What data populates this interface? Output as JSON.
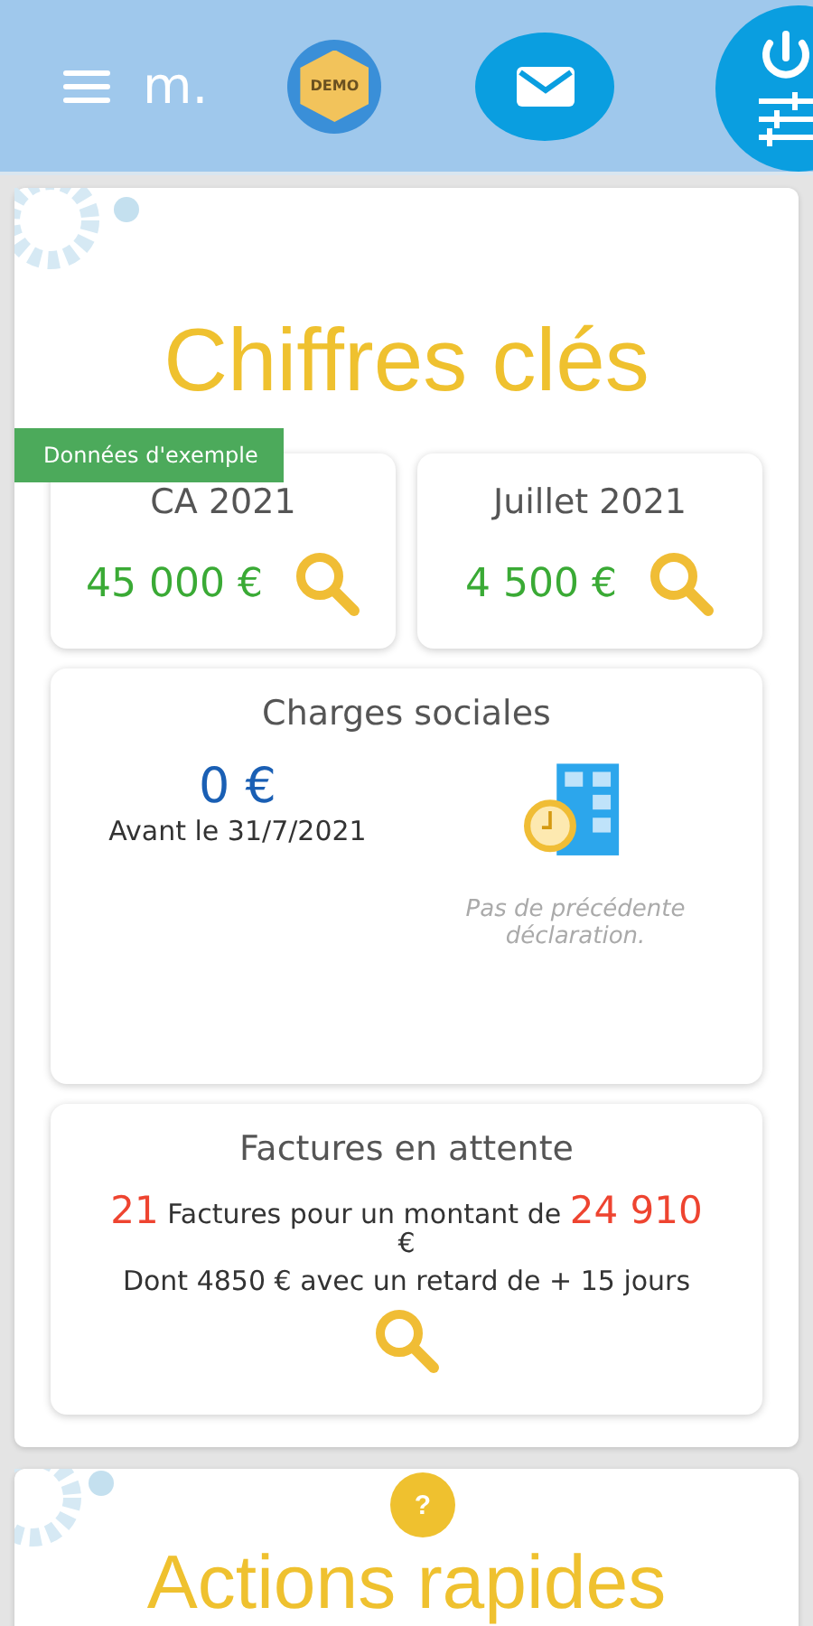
{
  "header": {
    "logo": "m.",
    "demo_badge": "DEMO"
  },
  "key_figures": {
    "title": "Chiffres clés",
    "sample_banner": "Données d'exemple",
    "tiles": [
      {
        "label": "CA 2021",
        "amount": "45 000 €"
      },
      {
        "label": "Juillet 2021",
        "amount": "4 500 €"
      }
    ],
    "social_charges": {
      "title": "Charges sociales",
      "amount": "0 €",
      "due": "Avant le 31/7/2021",
      "note": "Pas de précédente déclaration."
    },
    "pending_invoices": {
      "title": "Factures en attente",
      "count": "21",
      "text": "Factures pour un montant de",
      "amount": "24 910",
      "currency": "€",
      "overdue": "Dont 4850 € avec un retard de + 15 jours"
    }
  },
  "quick_actions": {
    "title": "Actions rapides",
    "help": "?"
  }
}
